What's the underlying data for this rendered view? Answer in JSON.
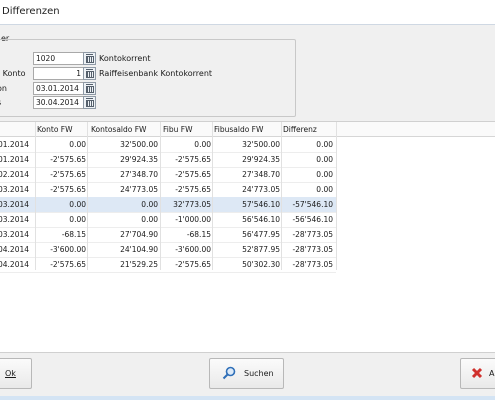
{
  "window": {
    "title": "Differenzen"
  },
  "filter": {
    "legend": "er",
    "rows": [
      {
        "label": "",
        "value": "1020",
        "align": "left",
        "desc": "Kontokorrent"
      },
      {
        "label": "t Konto",
        "value": "1",
        "align": "right",
        "desc": "Raiffeisenbank Kontokorrent"
      },
      {
        "label": "on",
        "value": "03.01.2014",
        "align": "left",
        "desc": ""
      },
      {
        "label": "s",
        "value": "30.04.2014",
        "align": "left",
        "desc": ""
      }
    ]
  },
  "table": {
    "headers": [
      "",
      "Konto FW",
      "Kontosaldo FW",
      "Fibu FW",
      "Fibusaldo FW",
      "Differenz"
    ],
    "rows": [
      {
        "cells": [
          "01.2014",
          "0.00",
          "32'500.00",
          "0.00",
          "32'500.00",
          "0.00"
        ],
        "selected": false
      },
      {
        "cells": [
          "01.2014",
          "-2'575.65",
          "29'924.35",
          "-2'575.65",
          "29'924.35",
          "0.00"
        ],
        "selected": false
      },
      {
        "cells": [
          "02.2014",
          "-2'575.65",
          "27'348.70",
          "-2'575.65",
          "27'348.70",
          "0.00"
        ],
        "selected": false
      },
      {
        "cells": [
          "03.2014",
          "-2'575.65",
          "24'773.05",
          "-2'575.65",
          "24'773.05",
          "0.00"
        ],
        "selected": false
      },
      {
        "cells": [
          "03.2014",
          "0.00",
          "0.00",
          "32'773.05",
          "57'546.10",
          "-57'546.10"
        ],
        "selected": true
      },
      {
        "cells": [
          "03.2014",
          "0.00",
          "0.00",
          "-1'000.00",
          "56'546.10",
          "-56'546.10"
        ],
        "selected": false
      },
      {
        "cells": [
          "03.2014",
          "-68.15",
          "27'704.90",
          "-68.15",
          "56'477.95",
          "-28'773.05"
        ],
        "selected": false
      },
      {
        "cells": [
          "04.2014",
          "-3'600.00",
          "24'104.90",
          "-3'600.00",
          "52'877.95",
          "-28'773.05"
        ],
        "selected": false
      },
      {
        "cells": [
          "04.2014",
          "-2'575.65",
          "21'529.25",
          "-2'575.65",
          "50'302.30",
          "-28'773.05"
        ],
        "selected": false
      }
    ]
  },
  "buttons": {
    "ok": "Ok",
    "search": "Suchen",
    "abort": "A"
  },
  "colors": {
    "selection": "#dde8f5",
    "accent": "#2f6fb8",
    "abort_icon": "#d0312d"
  }
}
